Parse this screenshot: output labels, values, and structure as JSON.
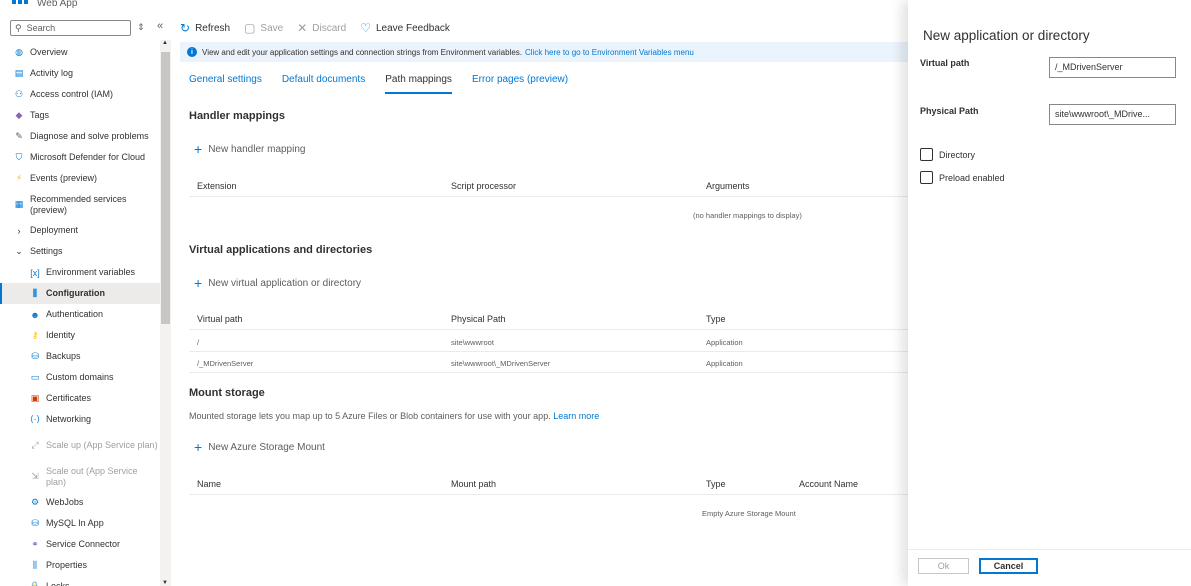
{
  "app": {
    "title": "Web App"
  },
  "nav": {
    "search_placeholder": "Search",
    "items": [
      {
        "label": "Overview",
        "icon": "overview-icon",
        "glyph": "◍",
        "color": "#0078d4"
      },
      {
        "label": "Activity log",
        "icon": "activity-log-icon",
        "glyph": "▤",
        "color": "#0078d4"
      },
      {
        "label": "Access control (IAM)",
        "icon": "iam-icon",
        "glyph": "⚇",
        "color": "#0078d4"
      },
      {
        "label": "Tags",
        "icon": "tag-icon",
        "glyph": "◆",
        "color": "#8764b8"
      },
      {
        "label": "Diagnose and solve problems",
        "icon": "wrench-icon",
        "glyph": "✎",
        "color": "#605e5c"
      },
      {
        "label": "Microsoft Defender for Cloud",
        "icon": "shield-icon",
        "glyph": "⛉",
        "color": "#0078d4"
      },
      {
        "label": "Events (preview)",
        "icon": "lightning-icon",
        "glyph": "⚡",
        "color": "#ffb900"
      },
      {
        "label": "Recommended services (preview)",
        "icon": "grid-icon",
        "glyph": "▦",
        "color": "#0078d4"
      },
      {
        "label": "Deployment",
        "icon": "chevron-right-icon",
        "glyph": "›",
        "color": "#323130"
      },
      {
        "label": "Settings",
        "icon": "chevron-down-icon",
        "glyph": "⌄",
        "color": "#323130"
      },
      {
        "label": "Environment variables",
        "icon": "env-vars-icon",
        "glyph": "[x]",
        "color": "#0078d4"
      },
      {
        "label": "Configuration",
        "icon": "sliders-icon",
        "glyph": "⫼",
        "color": "#0078d4"
      },
      {
        "label": "Authentication",
        "icon": "user-key-icon",
        "glyph": "☻",
        "color": "#0078d4"
      },
      {
        "label": "Identity",
        "icon": "identity-icon",
        "glyph": "⚷",
        "color": "#ffb900"
      },
      {
        "label": "Backups",
        "icon": "backup-icon",
        "glyph": "⛁",
        "color": "#0078d4"
      },
      {
        "label": "Custom domains",
        "icon": "domain-icon",
        "glyph": "▭",
        "color": "#0078d4"
      },
      {
        "label": "Certificates",
        "icon": "certificate-icon",
        "glyph": "▣",
        "color": "#d83b01"
      },
      {
        "label": "Networking",
        "icon": "network-icon",
        "glyph": "⟨·⟩",
        "color": "#0078d4"
      },
      {
        "label": "Scale up (App Service plan)",
        "icon": "scale-up-icon",
        "glyph": "⤢",
        "color": "#a19f9d"
      },
      {
        "label": "Scale out (App Service plan)",
        "icon": "scale-out-icon",
        "glyph": "⇲",
        "color": "#a19f9d"
      },
      {
        "label": "WebJobs",
        "icon": "webjobs-icon",
        "glyph": "⚙",
        "color": "#0078d4"
      },
      {
        "label": "MySQL In App",
        "icon": "mysql-icon",
        "glyph": "⛁",
        "color": "#0078d4"
      },
      {
        "label": "Service Connector",
        "icon": "connector-icon",
        "glyph": "⚭",
        "color": "#8764b8"
      },
      {
        "label": "Properties",
        "icon": "properties-icon",
        "glyph": "⫼",
        "color": "#0078d4"
      },
      {
        "label": "Locks",
        "icon": "lock-icon",
        "glyph": "🔒",
        "color": "#0078d4"
      }
    ]
  },
  "toolbar": {
    "refresh": "Refresh",
    "save": "Save",
    "discard": "Discard",
    "feedback": "Leave Feedback"
  },
  "banner": {
    "text": "View and edit your application settings and connection strings from Environment variables.",
    "link": "Click here to go to Environment Variables menu"
  },
  "tabs": [
    "General settings",
    "Default documents",
    "Path mappings",
    "Error pages (preview)"
  ],
  "handler": {
    "title": "Handler mappings",
    "add": "New handler mapping",
    "columns": [
      "Extension",
      "Script processor",
      "Arguments"
    ],
    "empty": "(no handler mappings to display)"
  },
  "virtual": {
    "title": "Virtual applications and directories",
    "add": "New virtual application or directory",
    "columns": [
      "Virtual path",
      "Physical Path",
      "Type"
    ],
    "rows": [
      {
        "path": "/",
        "physical": "site\\wwwroot",
        "type": "Application"
      },
      {
        "path": "/_MDrivenServer",
        "physical": "site\\wwwroot\\_MDrivenServer",
        "type": "Application"
      }
    ]
  },
  "mount": {
    "title": "Mount storage",
    "desc": "Mounted storage lets you map up to 5 Azure Files or Blob containers for use with your app.",
    "learn": "Learn more",
    "add": "New Azure Storage Mount",
    "columns": [
      "Name",
      "Mount path",
      "Type",
      "Account Name"
    ],
    "empty": "Empty Azure Storage Mount"
  },
  "panel": {
    "title": "New application or directory",
    "virtual_label": "Virtual path",
    "virtual_value": "/_MDrivenServer",
    "physical_label": "Physical Path",
    "physical_value": "site\\wwwroot\\_MDrive...",
    "directory": "Directory",
    "preload": "Preload enabled",
    "ok": "Ok",
    "cancel": "Cancel"
  }
}
